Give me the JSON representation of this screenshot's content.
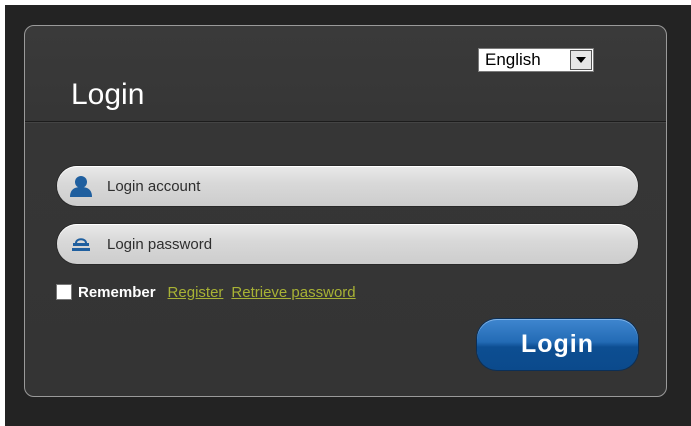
{
  "header": {
    "title": "Login"
  },
  "language": {
    "selected": "English",
    "options": [
      "English"
    ]
  },
  "form": {
    "account_placeholder": "Login account",
    "password_placeholder": "Login password",
    "account_icon": "user-icon",
    "password_icon": "lock-icon"
  },
  "options_row": {
    "remember_label": "Remember",
    "register_link": "Register",
    "retrieve_link": "Retrieve password"
  },
  "actions": {
    "login_label": "Login"
  },
  "colors": {
    "panel_bg": "#363636",
    "link": "#a8b235",
    "button": "#1f62a8",
    "icon": "#1f5f9f"
  }
}
